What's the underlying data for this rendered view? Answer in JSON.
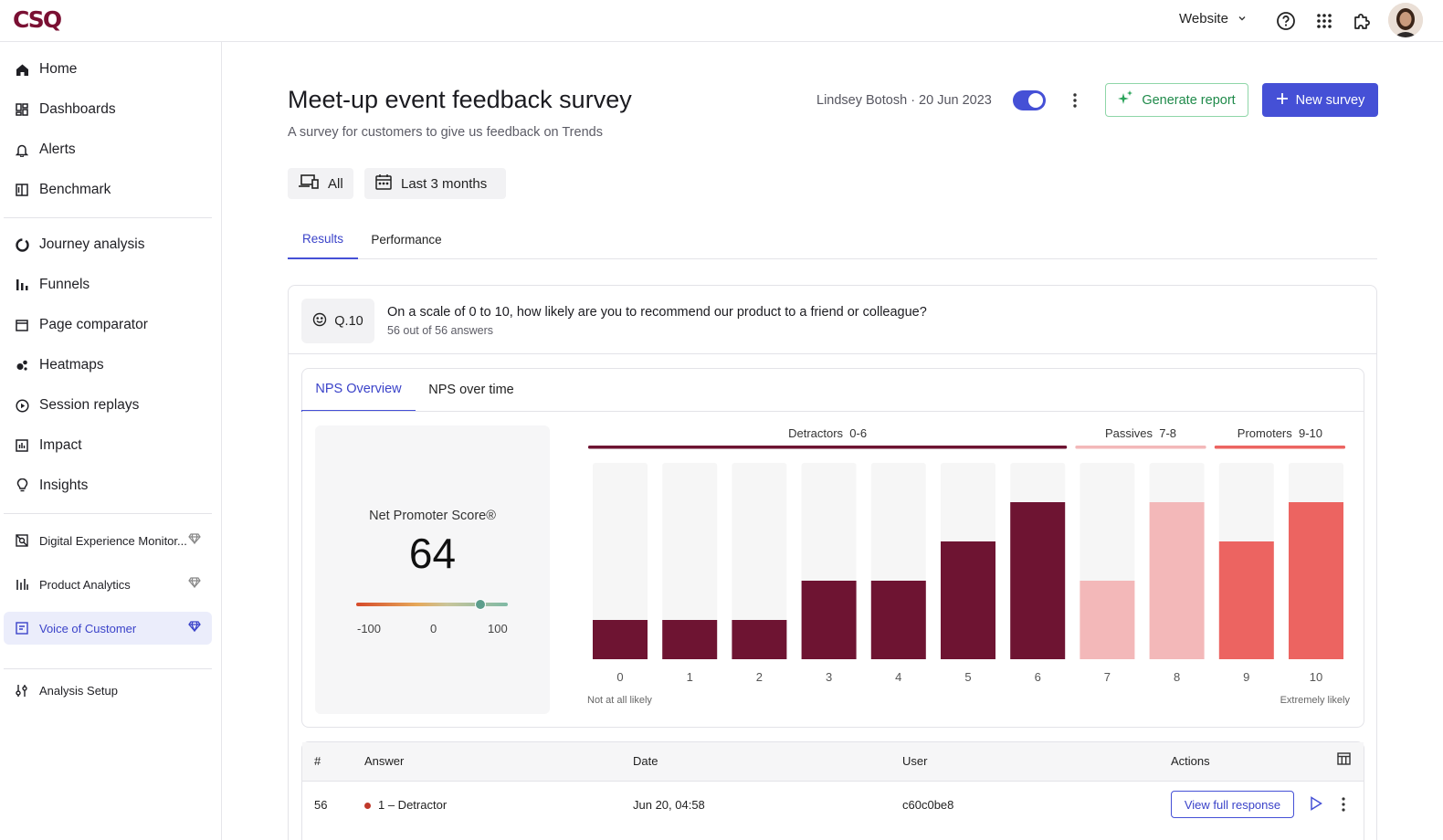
{
  "app": {
    "logo_text": "CSQ",
    "site_selector": "Website"
  },
  "sidebar": {
    "items": [
      {
        "label": "Home",
        "icon": "home-icon"
      },
      {
        "label": "Dashboards",
        "icon": "dashboard-icon"
      },
      {
        "label": "Alerts",
        "icon": "bell-icon"
      },
      {
        "label": "Benchmark",
        "icon": "benchmark-icon"
      },
      {
        "label": "Journey analysis",
        "icon": "journey-icon"
      },
      {
        "label": "Funnels",
        "icon": "funnel-icon"
      },
      {
        "label": "Page comparator",
        "icon": "page-icon"
      },
      {
        "label": "Heatmaps",
        "icon": "heatmap-icon"
      },
      {
        "label": "Session replays",
        "icon": "play-circle-icon"
      },
      {
        "label": "Impact",
        "icon": "impact-icon"
      },
      {
        "label": "Insights",
        "icon": "lightbulb-icon"
      },
      {
        "label": "Digital Experience Monitor...",
        "icon": "monitor-icon"
      },
      {
        "label": "Product Analytics",
        "icon": "analytics-icon"
      },
      {
        "label": "Voice of Customer",
        "icon": "voc-icon"
      },
      {
        "label": "Analysis Setup",
        "icon": "settings-sliders-icon"
      }
    ]
  },
  "header": {
    "title": "Meet-up event feedback survey",
    "subtitle": "A survey for customers to give us feedback on Trends",
    "author": "Lindsey Botosh",
    "date": "20 Jun 2023",
    "generate_report": "Generate report",
    "new_survey": "New survey"
  },
  "filters": {
    "device": "All",
    "period": "Last 3 months"
  },
  "tabs": [
    "Results",
    "Performance"
  ],
  "question": {
    "badge": "Q.10",
    "text": "On a scale of 0 to 10, how likely are you to recommend our product to a friend or colleague?",
    "answers": "56 out of 56 answers"
  },
  "subtabs": [
    "NPS Overview",
    "NPS over time"
  ],
  "nps": {
    "label": "Net Promoter Score®",
    "value": "64",
    "gauge_value": 64,
    "gauge_min": "-100",
    "gauge_mid": "0",
    "gauge_max": "100"
  },
  "chart_data": {
    "type": "bar",
    "groups": [
      {
        "name": "Detractors",
        "range": "0-6",
        "color": "#6e1432"
      },
      {
        "name": "Passives",
        "range": "7-8",
        "color": "#f3b8b9"
      },
      {
        "name": "Promoters",
        "range": "9-10",
        "color": "#ec6461"
      }
    ],
    "categories": [
      "0",
      "1",
      "2",
      "3",
      "4",
      "5",
      "6",
      "7",
      "8",
      "9",
      "10"
    ],
    "values": [
      1,
      1,
      1,
      2,
      2,
      3,
      4,
      2,
      4,
      3,
      4
    ],
    "bar_colors": [
      "#6e1432",
      "#6e1432",
      "#6e1432",
      "#6e1432",
      "#6e1432",
      "#6e1432",
      "#6e1432",
      "#f3b8b9",
      "#f3b8b9",
      "#ec6461",
      "#ec6461"
    ],
    "ylim": [
      0,
      5
    ],
    "low_label": "Not at all likely",
    "high_label": "Extremely likely"
  },
  "table": {
    "headers": [
      "#",
      "Answer",
      "Date",
      "User",
      "Actions"
    ],
    "rows": [
      {
        "num": "56",
        "answer": "1 – Detractor",
        "date": "Jun 20, 04:58",
        "user": "c60c0be8",
        "action": "View full response"
      }
    ]
  }
}
